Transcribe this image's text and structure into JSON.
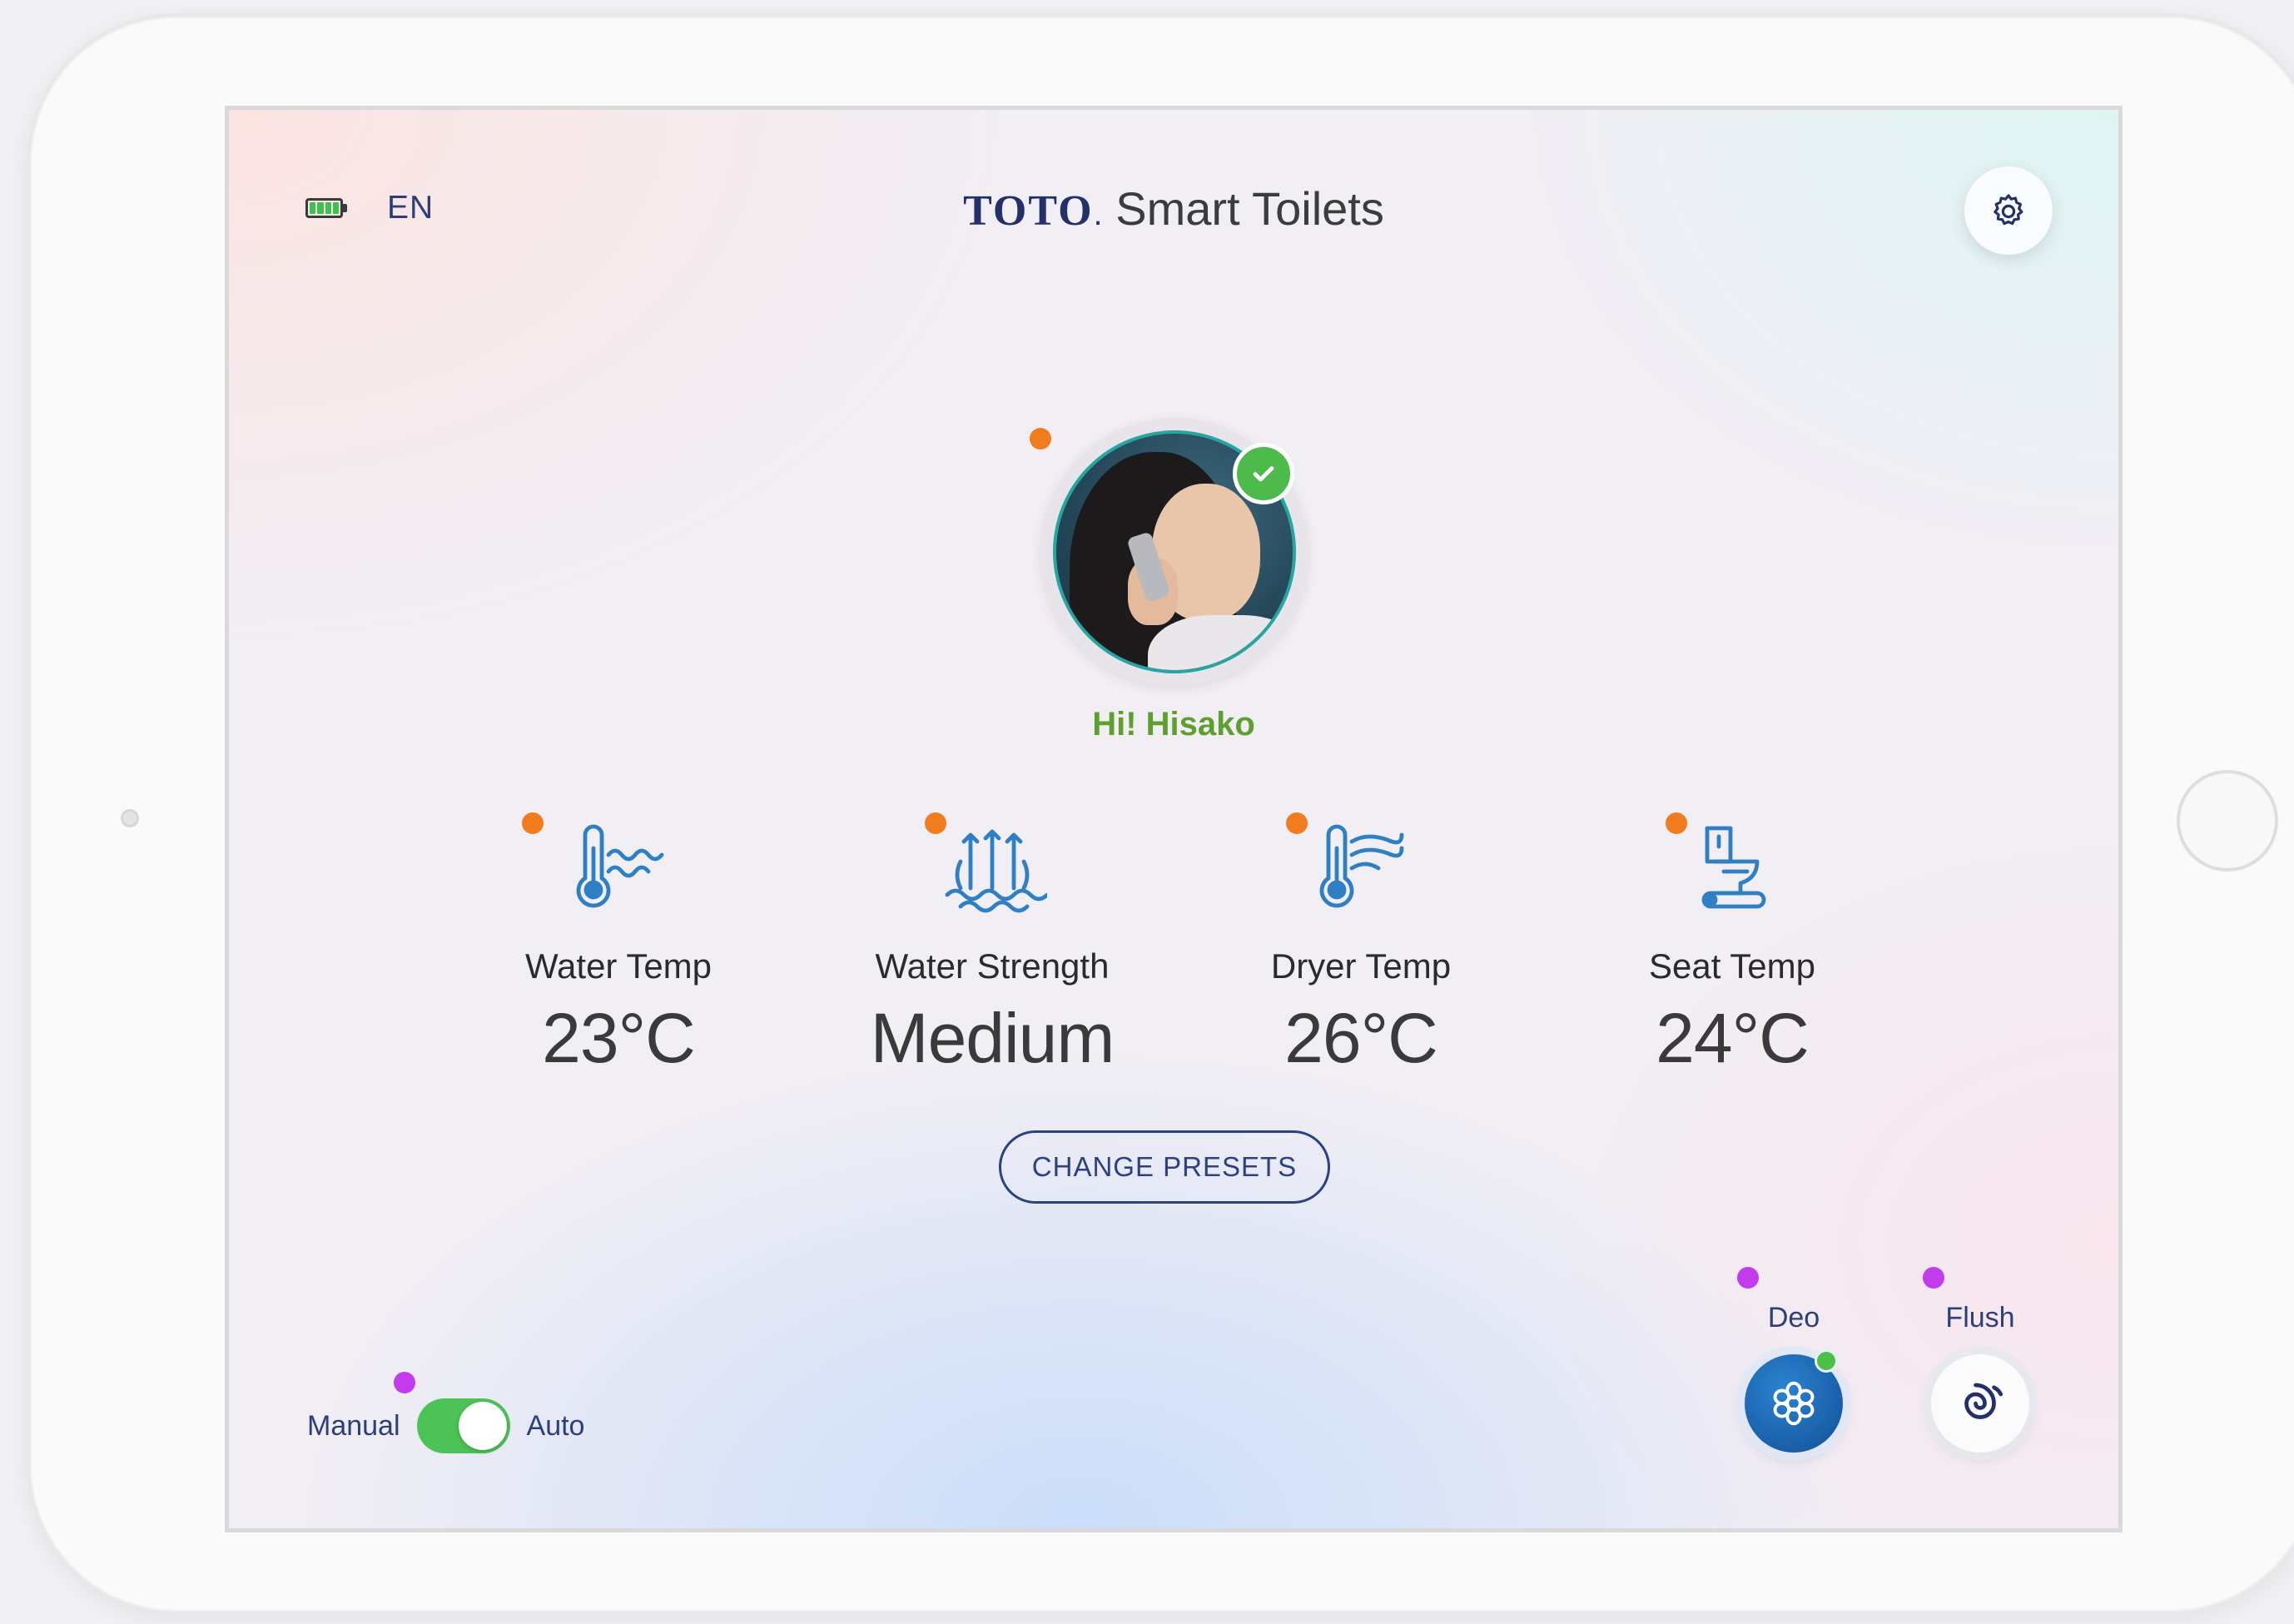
{
  "header": {
    "language": "EN",
    "brand_logo": "TOTO",
    "brand_logo_dot": ".",
    "brand_name": "Smart Toilets",
    "settings_icon": "gear-icon",
    "battery_icon": "battery-icon"
  },
  "user": {
    "greeting": "Hi! Hisako",
    "verified_icon": "check-icon"
  },
  "presets": [
    {
      "label": "Water Temp",
      "value": "23°C",
      "icon": "water-temp-icon"
    },
    {
      "label": "Water Strength",
      "value": "Medium",
      "icon": "water-strength-icon"
    },
    {
      "label": "Dryer Temp",
      "value": "26°C",
      "icon": "dryer-temp-icon"
    },
    {
      "label": "Seat Temp",
      "value": "24°C",
      "icon": "seat-temp-icon"
    }
  ],
  "change_presets_label": "CHANGE PRESETS",
  "mode": {
    "left_label": "Manual",
    "right_label": "Auto",
    "selected": "Auto"
  },
  "actions": {
    "deo": {
      "label": "Deo",
      "icon": "flower-icon",
      "active": true
    },
    "flush": {
      "label": "Flush",
      "icon": "swirl-icon",
      "active": false
    }
  },
  "colors": {
    "accent_green": "#5ea02f",
    "toggle_green": "#4dc357",
    "brand_navy": "#24306a",
    "icon_blue": "#2f7fc4",
    "marker_orange": "#f07c1d",
    "marker_purple": "#c23bed"
  }
}
